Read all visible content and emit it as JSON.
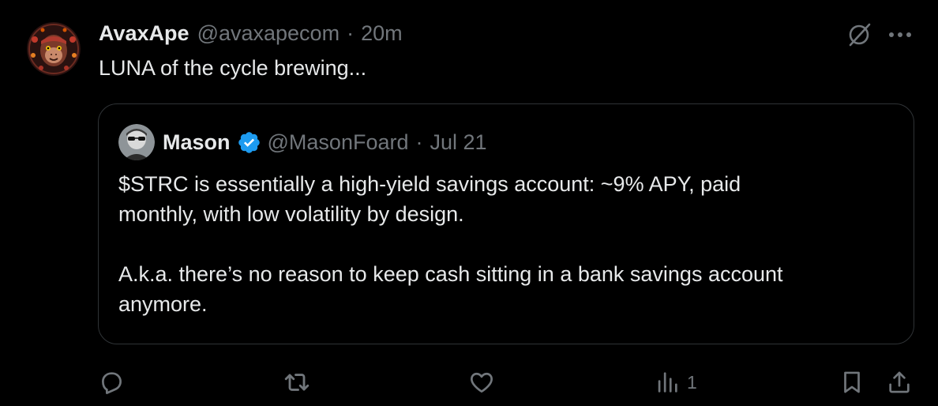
{
  "tweet": {
    "author": {
      "display_name": "AvaxApe",
      "handle": "@avaxapecom",
      "separator": "·",
      "time": "20m"
    },
    "text": "LUNA of the cycle brewing...",
    "top_actions": {
      "grok_icon": "grok-icon",
      "more_icon": "more-icon"
    }
  },
  "quote": {
    "author": {
      "display_name": "Mason",
      "handle": "@MasonFoard",
      "separator": "·",
      "date": "Jul 21",
      "verified": true
    },
    "paragraphs": [
      "$STRC is essentially a high-yield savings account: ~9% APY, paid",
      "monthly, with low volatility by design.",
      "",
      "A.k.a. there’s no reason to keep cash sitting in a bank savings account",
      "anymore."
    ]
  },
  "actions": {
    "reply": {
      "icon": "reply-icon",
      "count": ""
    },
    "repost": {
      "icon": "repost-icon",
      "count": ""
    },
    "like": {
      "icon": "heart-icon",
      "count": ""
    },
    "views": {
      "icon": "views-icon",
      "count": "1"
    },
    "bookmark": {
      "icon": "bookmark-icon"
    },
    "share": {
      "icon": "share-icon"
    }
  },
  "colors": {
    "background": "#000000",
    "text_primary": "#e7e9ea",
    "text_secondary": "#71767b",
    "border": "#2f3336",
    "verified_blue": "#1d9bf0"
  }
}
